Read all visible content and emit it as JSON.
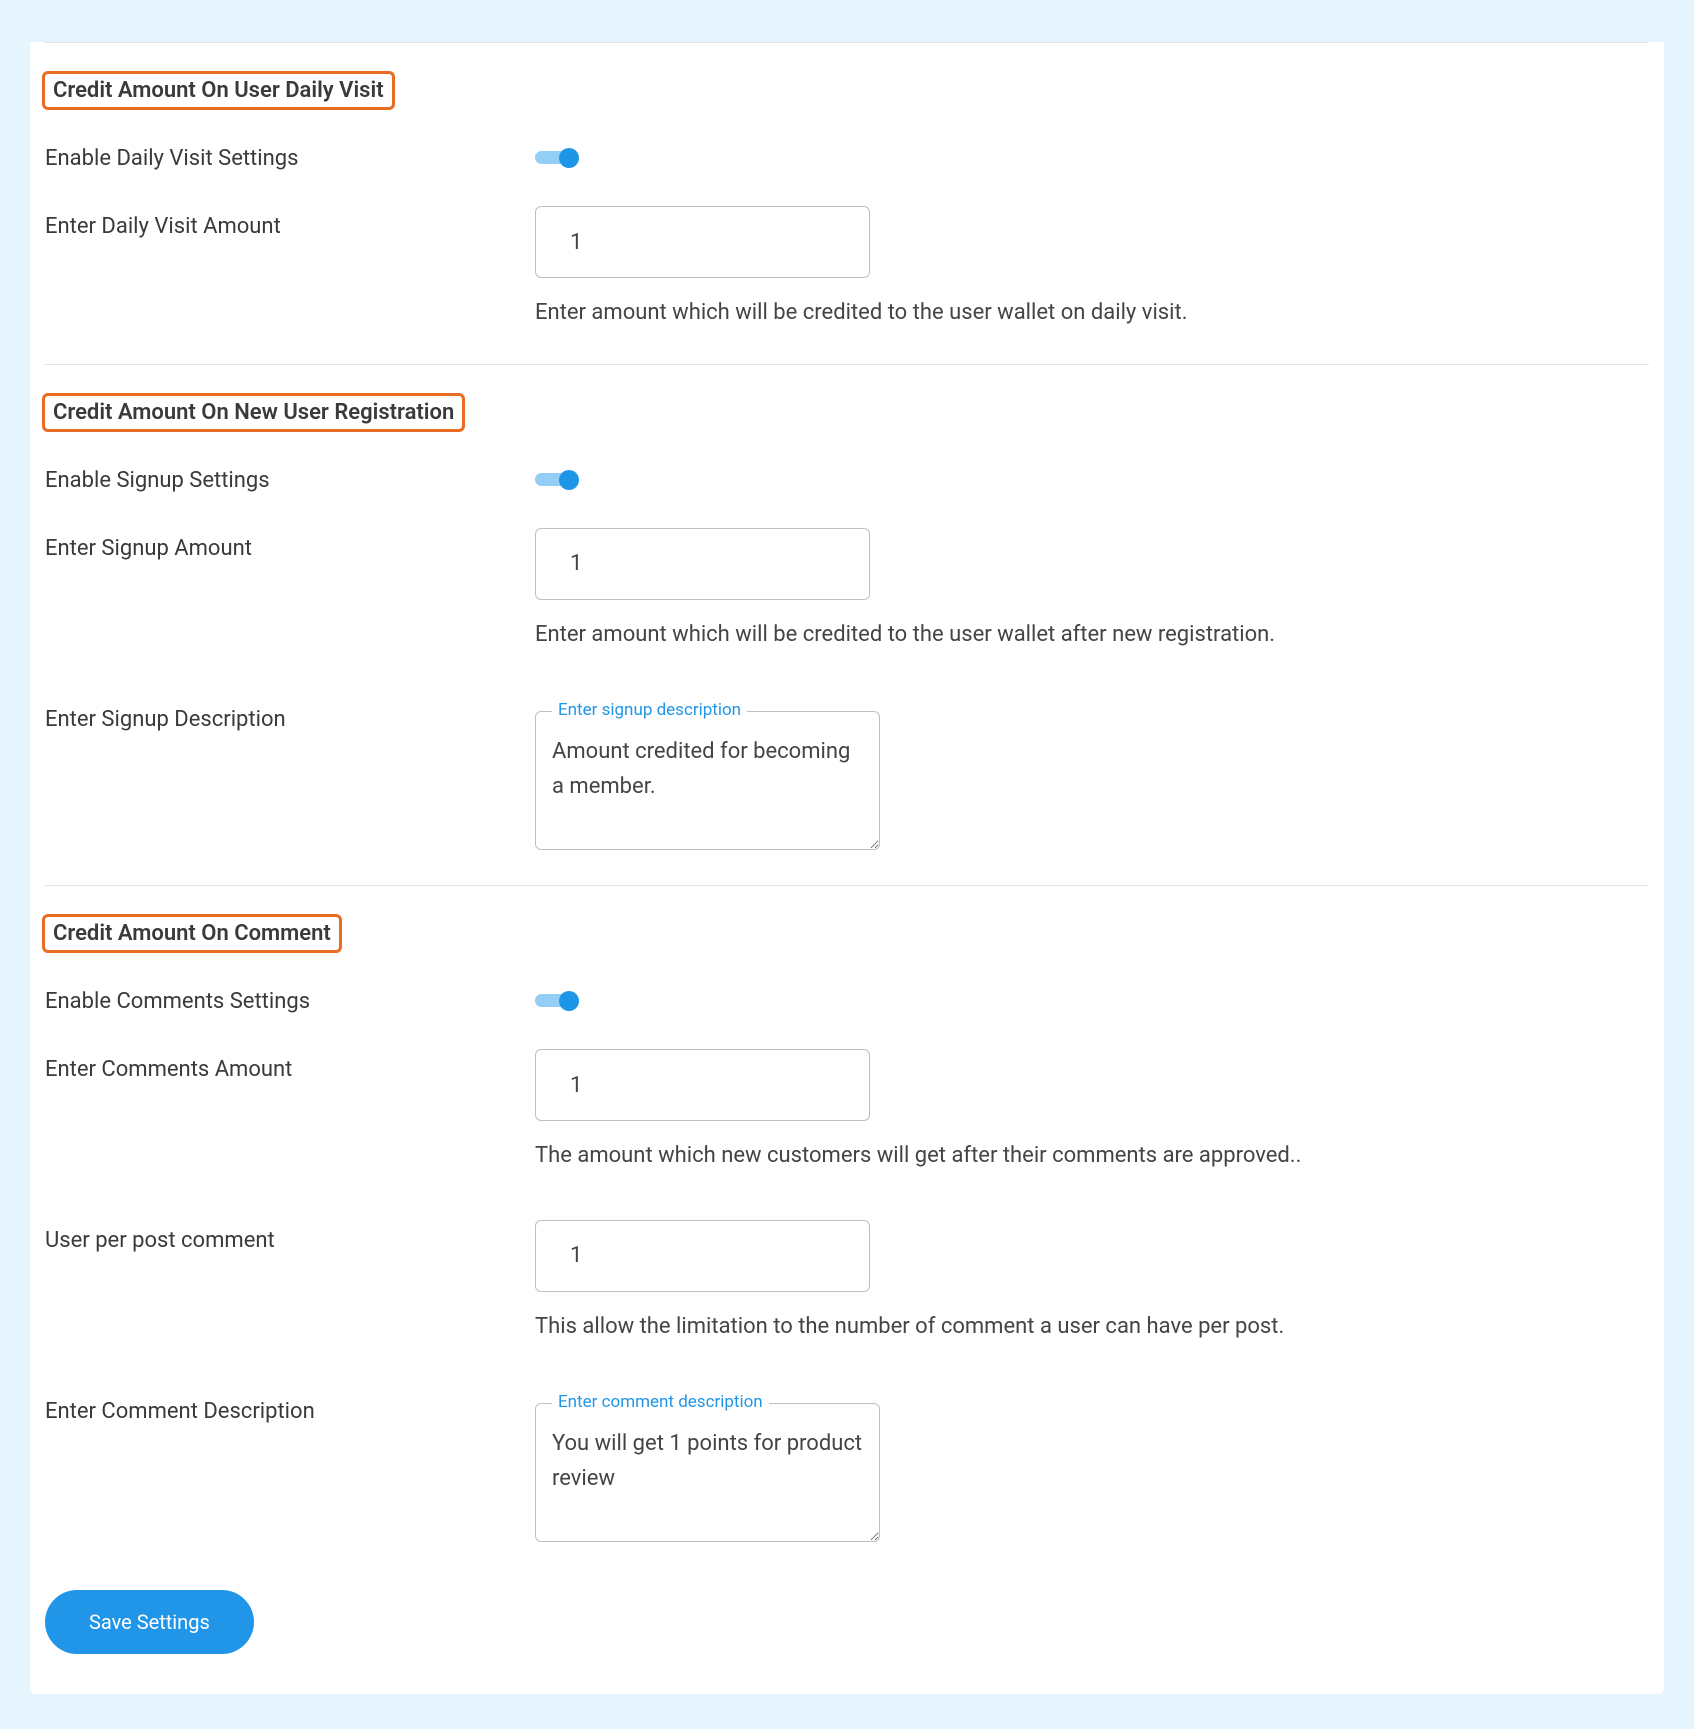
{
  "sections": {
    "daily_visit": {
      "title": "Credit Amount On User Daily Visit",
      "enable_label": "Enable Daily Visit Settings",
      "enable_state": true,
      "amount_label": "Enter Daily Visit Amount",
      "amount_value": "1",
      "amount_help": "Enter amount which will be credited to the user wallet on daily visit."
    },
    "signup": {
      "title": "Credit Amount On New User Registration",
      "enable_label": "Enable Signup Settings",
      "enable_state": true,
      "amount_label": "Enter Signup Amount",
      "amount_value": "1",
      "amount_help": "Enter amount which will be credited to the user wallet after new registration.",
      "desc_label": "Enter Signup Description",
      "desc_legend": "Enter signup description",
      "desc_value": "Amount credited for becoming a member."
    },
    "comment": {
      "title": "Credit Amount On Comment",
      "enable_label": "Enable Comments Settings",
      "enable_state": true,
      "amount_label": "Enter Comments Amount",
      "amount_value": "1",
      "amount_help": "The amount which new customers will get after their comments are approved..",
      "per_post_label": "User per post comment",
      "per_post_value": "1",
      "per_post_help": "This allow the limitation to the number of comment a user can have per post.",
      "desc_label": "Enter Comment Description",
      "desc_legend": "Enter comment description",
      "desc_value": "You will get 1 points for product review"
    }
  },
  "buttons": {
    "save": "Save Settings"
  }
}
